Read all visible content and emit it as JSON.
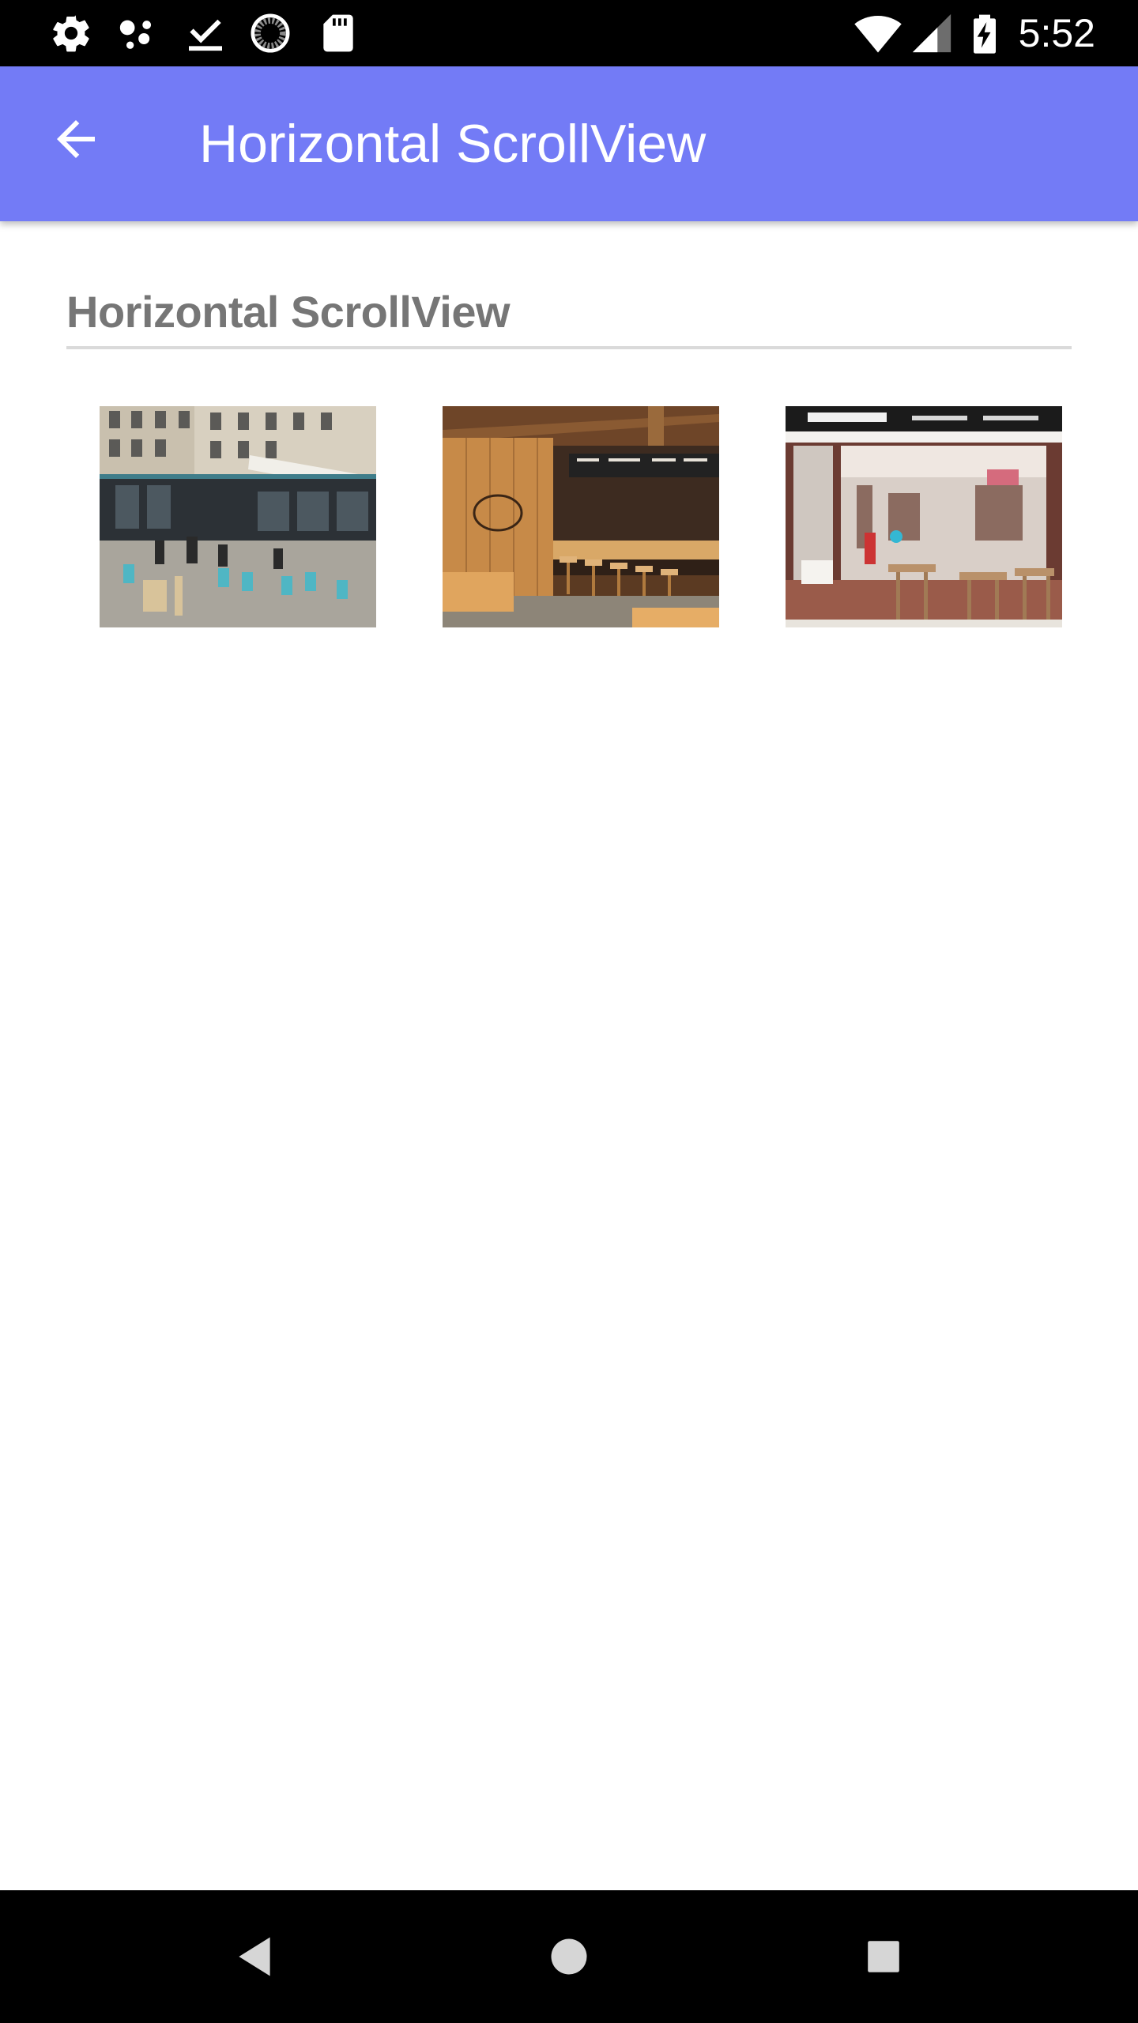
{
  "status_bar": {
    "time": "5:52",
    "left_icons": [
      "gear-icon",
      "assistant-dots-icon",
      "download-done-icon",
      "progress-circle-icon",
      "sd-card-icon"
    ],
    "right_icons": [
      "wifi-icon",
      "signal-icon",
      "battery-charging-icon"
    ]
  },
  "app_bar": {
    "title": "Horizontal ScrollView",
    "back_icon": "arrow-back-icon",
    "color": "#737bf6"
  },
  "content": {
    "section_title": "Horizontal ScrollView",
    "images": [
      {
        "subject": "Corner street cafe with outdoor blue chairs"
      },
      {
        "subject": "Wooden coffee shop interior with bar stools"
      },
      {
        "subject": "Cafe storefront with outdoor wooden tables"
      }
    ]
  },
  "nav_bar": {
    "buttons": [
      "back-triangle-icon",
      "home-circle-icon",
      "recents-square-icon"
    ]
  }
}
